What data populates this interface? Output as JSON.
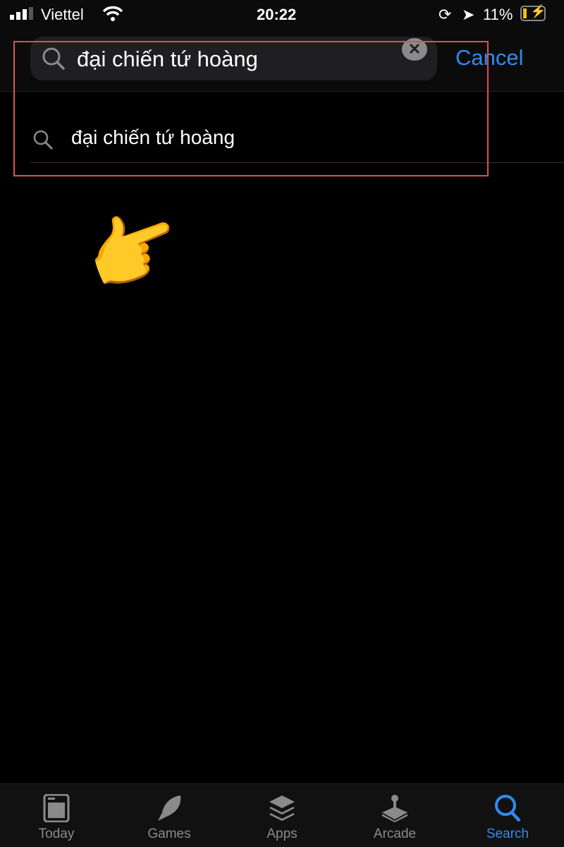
{
  "status": {
    "carrier": "Viettel",
    "time": "20:22",
    "battery": "11%"
  },
  "search": {
    "query": "đại chiến tứ hoàng",
    "cancel": "Cancel",
    "clear_icon": "close-icon"
  },
  "suggestions": [
    {
      "text": "đại chiến tứ hoàng"
    }
  ],
  "annotation": {
    "highlight_color": "#d9534f",
    "pointer": "👉"
  },
  "tabs": [
    {
      "label": "Today"
    },
    {
      "label": "Games"
    },
    {
      "label": "Apps"
    },
    {
      "label": "Arcade"
    },
    {
      "label": "Search",
      "active": true
    }
  ],
  "colors": {
    "accent": "#2f8cf0"
  }
}
